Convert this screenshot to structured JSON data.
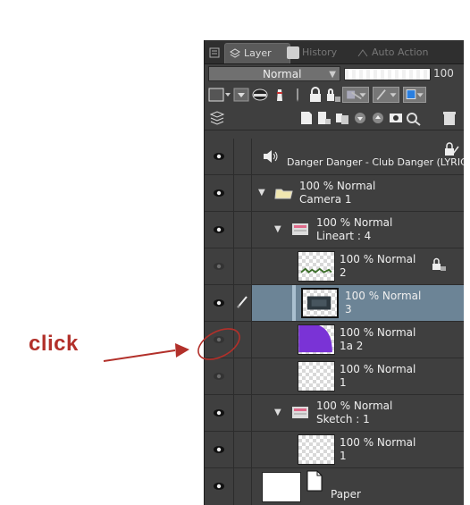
{
  "tabs": [
    {
      "label": "Layer",
      "active": true
    },
    {
      "label": "History",
      "active": false
    },
    {
      "label": "Auto Action",
      "active": false
    }
  ],
  "blend_mode": "Normal",
  "opacity_value": "100",
  "opacity_fraction": 1.0,
  "layers": [
    {
      "kind": "audio",
      "name": "Danger Danger - Club Danger (LYRICS)",
      "visible": true
    },
    {
      "kind": "camera-folder",
      "line1": "100 % Normal",
      "line2": "Camera 1",
      "visible": true
    },
    {
      "kind": "folder",
      "line1": "100 % Normal",
      "line2": "Lineart : 4",
      "visible": true
    },
    {
      "kind": "raster",
      "line1": "100 % Normal",
      "line2": "2",
      "visible": false
    },
    {
      "kind": "raster",
      "line1": "100 % Normal",
      "line2": "3",
      "visible": true,
      "selected": true
    },
    {
      "kind": "raster",
      "line1": "100 % Normal",
      "line2": "1a 2",
      "visible": false
    },
    {
      "kind": "raster",
      "line1": "100 % Normal",
      "line2": "1",
      "visible": false
    },
    {
      "kind": "folder",
      "line1": "100 % Normal",
      "line2": "Sketch : 1",
      "visible": true
    },
    {
      "kind": "raster",
      "line1": "100 % Normal",
      "line2": "1",
      "visible": true
    },
    {
      "kind": "paper",
      "name": "Paper",
      "visible": true
    }
  ],
  "annotation": {
    "text": "click",
    "color": "#b2302a"
  },
  "colors": {
    "panel_bg": "#3f3f3f",
    "selected_row": "#6c8496",
    "thumb_purple": "#7a33d6"
  }
}
